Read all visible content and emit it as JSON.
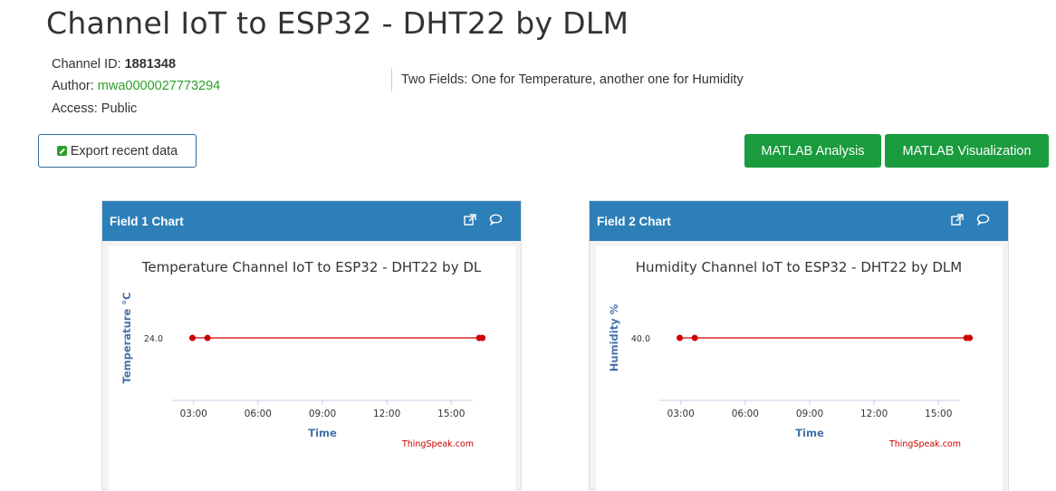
{
  "page": {
    "title": "Channel IoT to ESP32 - DHT22 by DLM",
    "channel_id_label": "Channel ID:",
    "channel_id": "1881348",
    "author_label": "Author:",
    "author": "mwa0000027773294",
    "access_label": "Access:",
    "access": "Public",
    "description": "Two Fields: One for Temperature, another one for Humidity"
  },
  "buttons": {
    "export": "Export recent data",
    "matlab_analysis": "MATLAB Analysis",
    "matlab_visualization": "MATLAB Visualization"
  },
  "panels": [
    {
      "label": "Field 1 Chart",
      "icons": [
        "external-link-icon",
        "comment-icon"
      ]
    },
    {
      "label": "Field 2 Chart",
      "icons": [
        "external-link-icon",
        "comment-icon"
      ]
    }
  ],
  "chart_data": [
    {
      "type": "line",
      "title": "Temperature Channel IoT to ESP32 - DHT22 by DL",
      "xlabel": "Time",
      "ylabel": "Temperature °C",
      "x_ticks": [
        "03:00",
        "06:00",
        "09:00",
        "12:00",
        "15:00"
      ],
      "x_range_hours": [
        2.0,
        16.0
      ],
      "y_ticks": [
        "24.0"
      ],
      "series": [
        {
          "x": [
            2.95,
            3.65,
            16.3,
            16.45
          ],
          "values": [
            24.0,
            24.0,
            24.0,
            24.0
          ],
          "color": "#cc0000"
        }
      ],
      "credit": "ThingSpeak.com"
    },
    {
      "type": "line",
      "title": "Humidity Channel IoT to ESP32 - DHT22 by DLM",
      "xlabel": "Time",
      "ylabel": "Humidity %",
      "x_ticks": [
        "03:00",
        "06:00",
        "09:00",
        "12:00",
        "15:00"
      ],
      "x_range_hours": [
        2.0,
        16.0
      ],
      "y_ticks": [
        "40.0"
      ],
      "series": [
        {
          "x": [
            2.95,
            3.65,
            16.3,
            16.45
          ],
          "values": [
            40.0,
            40.0,
            40.0,
            40.0
          ],
          "color": "#cc0000"
        }
      ],
      "credit": "ThingSpeak.com"
    }
  ],
  "colors": {
    "header_blue": "#2d7fb8",
    "button_green": "#1a9b3e",
    "link_green": "#2aa02a",
    "series_red": "#cc0000"
  }
}
